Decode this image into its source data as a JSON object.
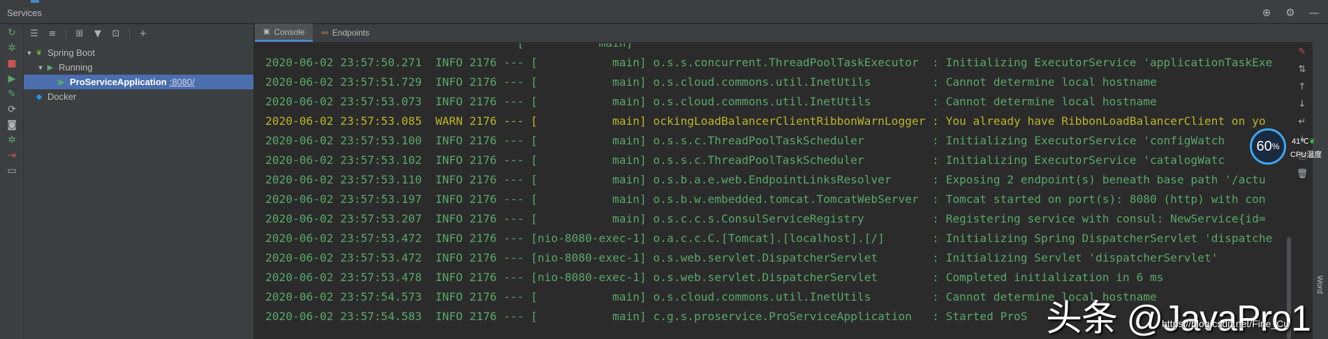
{
  "colors": {
    "accent": "#4a88c7",
    "info": "#59a869",
    "warn": "#bbb529",
    "selection": "#4b6eaf",
    "run_green": "#59a869",
    "stop_red": "#c75450"
  },
  "window": {
    "title": "Services"
  },
  "tree": {
    "nodes": [
      {
        "label": "Spring Boot",
        "icon": "spring-leaf-icon"
      },
      {
        "label": "Running",
        "icon": "run-triangle-icon"
      },
      {
        "label": "ProServiceApplication",
        "port": ":8080/",
        "icon": "run-triangle-icon"
      },
      {
        "label": "Docker",
        "icon": "docker-whale-icon"
      }
    ]
  },
  "tabs": [
    {
      "label": "Console",
      "icon": "console-icon"
    },
    {
      "label": "Endpoints",
      "icon": "endpoints-icon"
    }
  ],
  "console": {
    "cut_line": "                                     [           main]",
    "lines": [
      {
        "level": "info",
        "text": "2020-06-02 23:57:50.271  INFO 2176 --- [           main] o.s.s.concurrent.ThreadPoolTaskExecutor  : Initializing ExecutorService 'applicationTaskExe"
      },
      {
        "level": "info",
        "text": "2020-06-02 23:57:51.729  INFO 2176 --- [           main] o.s.cloud.commons.util.InetUtils         : Cannot determine local hostname"
      },
      {
        "level": "info",
        "text": "2020-06-02 23:57:53.073  INFO 2176 --- [           main] o.s.cloud.commons.util.InetUtils         : Cannot determine local hostname"
      },
      {
        "level": "warn",
        "text": "2020-06-02 23:57:53.085  WARN 2176 --- [           main] ockingLoadBalancerClientRibbonWarnLogger : You already have RibbonLoadBalancerClient on yo"
      },
      {
        "level": "info",
        "text": "2020-06-02 23:57:53.100  INFO 2176 --- [           main] o.s.s.c.ThreadPoolTaskScheduler          : Initializing ExecutorService 'configWatch"
      },
      {
        "level": "info",
        "text": "2020-06-02 23:57:53.102  INFO 2176 --- [           main] o.s.s.c.ThreadPoolTaskScheduler          : Initializing ExecutorService 'catalogWatc"
      },
      {
        "level": "info",
        "text": "2020-06-02 23:57:53.110  INFO 2176 --- [           main] o.s.b.a.e.web.EndpointLinksResolver      : Exposing 2 endpoint(s) beneath base path '/actu"
      },
      {
        "level": "info",
        "text": "2020-06-02 23:57:53.197  INFO 2176 --- [           main] o.s.b.w.embedded.tomcat.TomcatWebServer  : Tomcat started on port(s): 8080 (http) with con"
      },
      {
        "level": "info",
        "text": "2020-06-02 23:57:53.207  INFO 2176 --- [           main] o.s.c.c.s.ConsulServiceRegistry          : Registering service with consul: NewService{id="
      },
      {
        "level": "info",
        "text": "2020-06-02 23:57:53.472  INFO 2176 --- [nio-8080-exec-1] o.a.c.c.C.[Tomcat].[localhost].[/]       : Initializing Spring DispatcherServlet 'dispatche"
      },
      {
        "level": "info",
        "text": "2020-06-02 23:57:53.472  INFO 2176 --- [nio-8080-exec-1] o.s.web.servlet.DispatcherServlet        : Initializing Servlet 'dispatcherServlet'"
      },
      {
        "level": "info",
        "text": "2020-06-02 23:57:53.478  INFO 2176 --- [nio-8080-exec-1] o.s.web.servlet.DispatcherServlet        : Completed initialization in 6 ms"
      },
      {
        "level": "info",
        "text": "2020-06-02 23:57:54.573  INFO 2176 --- [           main] o.s.cloud.commons.util.InetUtils         : Cannot determine local hostname"
      },
      {
        "level": "info",
        "text": "2020-06-02 23:57:54.583  INFO 2176 --- [           main] c.g.s.proservice.ProServiceApplication   : Started ProS"
      }
    ]
  },
  "overlay": {
    "cpu_percent": "60",
    "cpu_unit": "%",
    "cpu_temp": "41℃",
    "cpu_label": "CPU温度",
    "watermark": "头条 @JavaPro1",
    "watermark_url": "https://blog.csdn.net/Fine_Cu",
    "side_label": "Word"
  }
}
